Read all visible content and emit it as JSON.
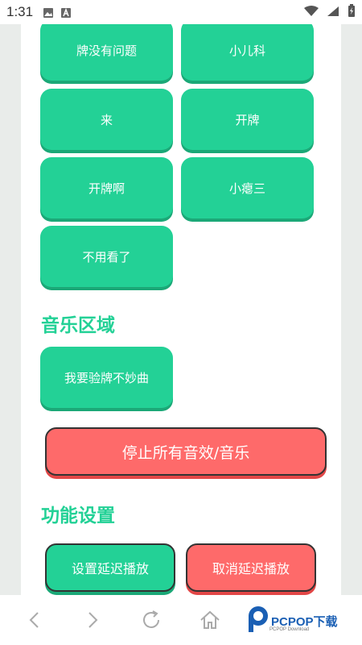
{
  "status": {
    "time": "1:31",
    "icons": [
      "image-icon",
      "app-a-icon",
      "wifi-icon",
      "signal-icon",
      "battery-icon"
    ]
  },
  "buttons": {
    "row1": [
      "牌没有问题",
      "小儿科"
    ],
    "row2": [
      "来",
      "开牌"
    ],
    "row3": [
      "开牌啊",
      "小瘪三"
    ],
    "row4": [
      "不用看了"
    ]
  },
  "music": {
    "title": "音乐区域",
    "track": "我要验牌不妙曲"
  },
  "stop_all": "停止所有音效/音乐",
  "settings": {
    "title": "功能设置",
    "set_delay": "设置延迟播放",
    "cancel_delay": "取消延迟播放"
  },
  "nav": [
    "back-icon",
    "forward-icon",
    "refresh-icon",
    "home-icon"
  ],
  "brand": {
    "name": "PCPOP下载",
    "sub": "PCPOP Download"
  },
  "colors": {
    "accent_green": "#23d196",
    "danger_red": "#fe6a6a"
  }
}
